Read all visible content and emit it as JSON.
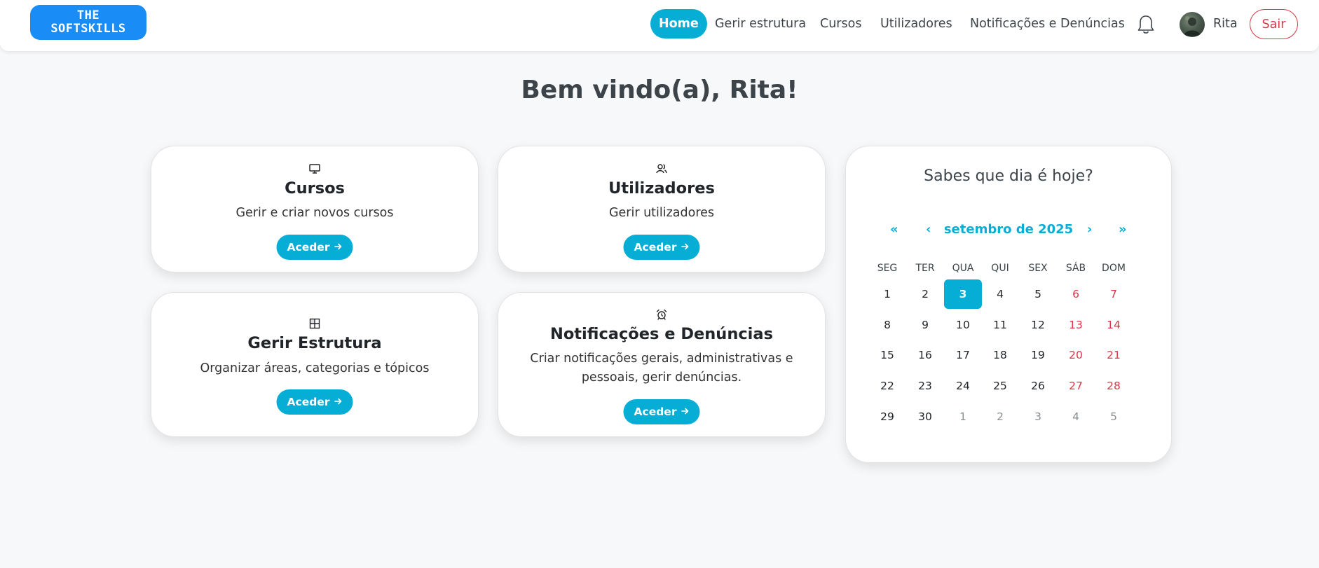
{
  "brand": {
    "line1": "THE",
    "line2": "SOFTSKILLS",
    "color": "#1a8cf5"
  },
  "nav": {
    "items": [
      {
        "label": "Home",
        "active": true
      },
      {
        "label": "Gerir estrutura",
        "active": false
      },
      {
        "label": "Cursos",
        "active": false
      },
      {
        "label": "Utilizadores",
        "active": false
      },
      {
        "label": "Notificações e Denúncias",
        "active": false
      }
    ],
    "bell_icon": "bell-icon",
    "user_name": "Rita",
    "logout_label": "Sair"
  },
  "welcome": "Bem vindo(a), Rita!",
  "cards": [
    {
      "icon": "monitor-icon",
      "title": "Cursos",
      "description": "Gerir e criar novos cursos",
      "button": "Aceder"
    },
    {
      "icon": "users-icon",
      "title": "Utilizadores",
      "description": "Gerir utilizadores",
      "button": "Aceder"
    },
    {
      "icon": "grid-icon",
      "title": "Gerir Estrutura",
      "description": "Organizar áreas, categorias e tópicos",
      "button": "Aceder"
    },
    {
      "icon": "alarm-icon",
      "title": "Notificações e Denúncias",
      "description": "Criar notificações gerais, administrativas e pessoais, gerir denúncias.",
      "button": "Aceder"
    }
  ],
  "calendar": {
    "title": "Sabes que dia é hoje?",
    "month_label": "setembro de 2025",
    "prev_year": "«",
    "prev_month": "‹",
    "next_month": "›",
    "next_year": "»",
    "weekdays": [
      "SEG",
      "TER",
      "QUA",
      "QUI",
      "SEX",
      "SÁB",
      "DOM"
    ],
    "weeks": [
      [
        "1",
        "2",
        "3",
        "4",
        "5",
        "6",
        "7"
      ],
      [
        "8",
        "9",
        "10",
        "11",
        "12",
        "13",
        "14"
      ],
      [
        "15",
        "16",
        "17",
        "18",
        "19",
        "20",
        "21"
      ],
      [
        "22",
        "23",
        "24",
        "25",
        "26",
        "27",
        "28"
      ],
      [
        "29",
        "30",
        "1",
        "2",
        "3",
        "4",
        "5"
      ]
    ],
    "today": "3",
    "accent": "#06aed5",
    "weekend_color": "#dc3545"
  },
  "accent": "#06aed5",
  "danger": "#dc3545"
}
